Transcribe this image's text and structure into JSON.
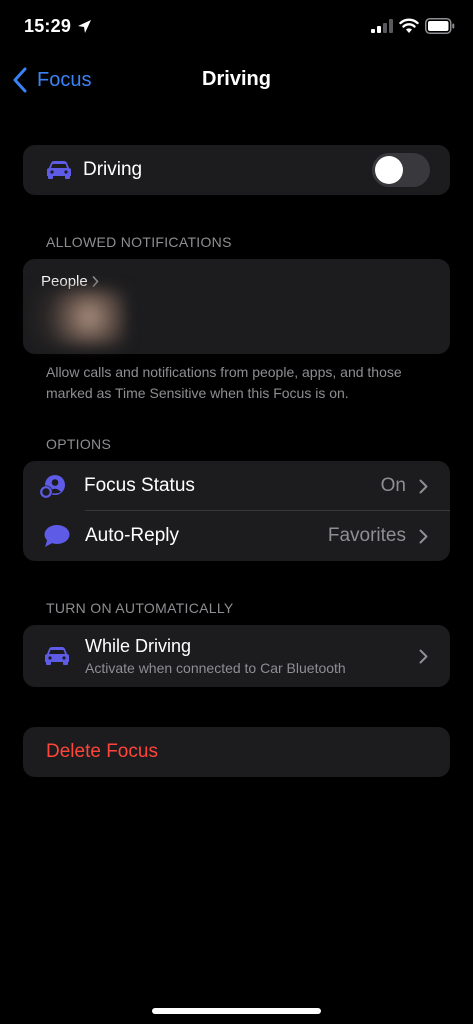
{
  "status": {
    "time": "15:29"
  },
  "nav": {
    "back_label": "Focus",
    "title": "Driving"
  },
  "focus_toggle": {
    "label": "Driving",
    "enabled": false
  },
  "allowed_notifications": {
    "header": "ALLOWED NOTIFICATIONS",
    "people_label": "People",
    "footer": "Allow calls and notifications from people, apps, and those marked as Time Sensitive when this Focus is on."
  },
  "options": {
    "header": "OPTIONS",
    "items": [
      {
        "label": "Focus Status",
        "value": "On"
      },
      {
        "label": "Auto-Reply",
        "value": "Favorites"
      }
    ]
  },
  "turn_on_automatically": {
    "header": "TURN ON AUTOMATICALLY",
    "item": {
      "title": "While Driving",
      "subtitle": "Activate when connected to Car Bluetooth"
    }
  },
  "delete": {
    "label": "Delete Focus"
  },
  "colors": {
    "accent": "#3b82f6",
    "icon_purple": "#5e5ce6",
    "destructive": "#ff453a",
    "card": "#1c1c1e"
  }
}
